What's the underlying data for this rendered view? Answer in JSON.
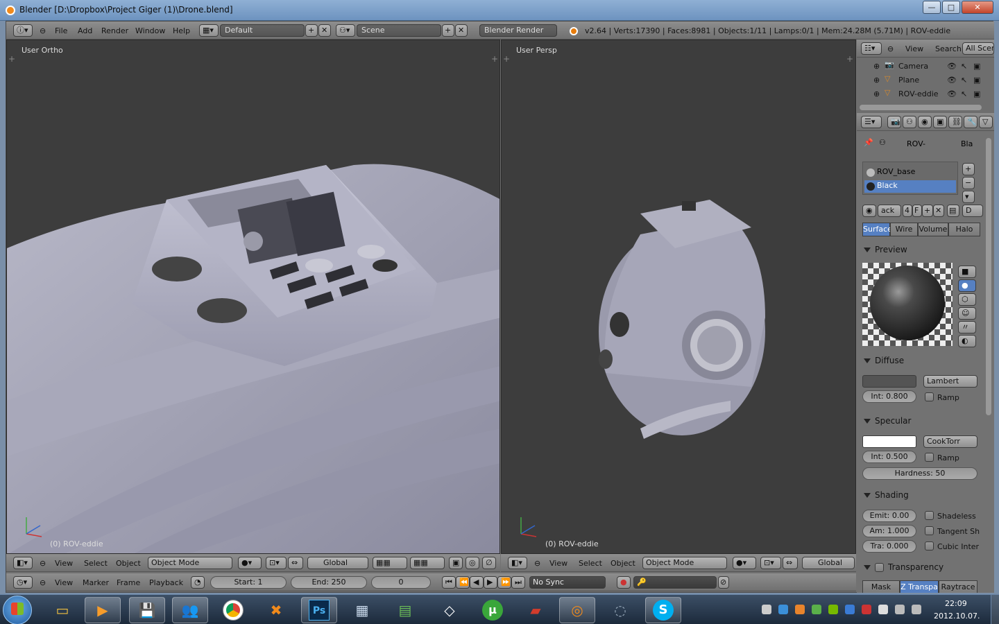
{
  "window": {
    "title": "Blender  [D:\\Dropbox\\Project Giger (1)\\Drone.blend]",
    "min_label": "—",
    "max_label": "□",
    "close_label": "✕"
  },
  "info_header": {
    "menus": [
      "File",
      "Add",
      "Render",
      "Window",
      "Help"
    ],
    "screen_layout": "Default",
    "scene": "Scene",
    "render_engine": "Blender Render",
    "stats": "v2.64 | Verts:17390 | Faces:8981 | Objects:1/11 | Lamps:0/1 | Mem:24.28M (5.71M) | ROV-eddie"
  },
  "viewport_left": {
    "label": "User Ortho",
    "object_label": "(0) ROV-eddie",
    "menus": [
      "View",
      "Select",
      "Object"
    ],
    "mode": "Object Mode",
    "orientation": "Global"
  },
  "viewport_right": {
    "label": "User Persp",
    "object_label": "(0) ROV-eddie",
    "menus": [
      "View",
      "Select",
      "Object"
    ],
    "mode": "Object Mode",
    "orientation": "Global"
  },
  "timeline": {
    "menus": [
      "View",
      "Marker",
      "Frame",
      "Playback"
    ],
    "start": "Start: 1",
    "end": "End: 250",
    "current": "0",
    "sync": "No Sync"
  },
  "outliner": {
    "menus": [
      "View",
      "Search"
    ],
    "filter": "All Scer",
    "items": [
      {
        "label": "Camera",
        "icon": "camera-icon"
      },
      {
        "label": "Plane",
        "icon": "mesh-icon"
      },
      {
        "label": "ROV-eddie",
        "icon": "mesh-icon"
      }
    ]
  },
  "properties": {
    "breadcrumb_object": "ROV-",
    "breadcrumb_material": "Bla",
    "material_slots": [
      "ROV_base",
      "Black"
    ],
    "selected_slot": "Black",
    "material_name": "ack",
    "users": "4",
    "fake_user": "F",
    "data_label": "D",
    "tabs": [
      "Surface",
      "Wire",
      "Volume",
      "Halo"
    ],
    "selected_tab": "Surface",
    "preview": {
      "title": "Preview"
    },
    "diffuse": {
      "title": "Diffuse",
      "shader": "Lambert",
      "intensity": "Int: 0.800",
      "ramp": "Ramp",
      "color": "#545454"
    },
    "specular": {
      "title": "Specular",
      "shader": "CookTorr",
      "intensity": "Int: 0.500",
      "ramp": "Ramp",
      "hardness": "Hardness: 50",
      "color": "#ffffff"
    },
    "shading": {
      "title": "Shading",
      "emit": "Emit: 0.00",
      "ambient": "Am: 1.000",
      "translucency": "Tra: 0.000",
      "shadeless": "Shadeless",
      "tangent": "Tangent Sh",
      "cubic": "Cubic Inter"
    },
    "transparency": {
      "title": "Transparency",
      "mask": "Mask",
      "ztransp": "Z Transpa",
      "raytrace": "Raytrace"
    }
  },
  "taskbar": {
    "apps": [
      "Windows Explorer",
      "Windows Media Player",
      "Save",
      "Network",
      "Chrome",
      "Chat",
      "Photoshop",
      "Calculator",
      "Task Manager",
      "Unity",
      "uTorrent",
      "Folder",
      "Blender",
      "Loading",
      "Skype"
    ],
    "time": "22:09",
    "date": "2012.10.07."
  },
  "colors": {
    "accent_blue": "#5680c2",
    "viewport_bg": "#3d3d3d",
    "panel_bg": "#727272"
  }
}
